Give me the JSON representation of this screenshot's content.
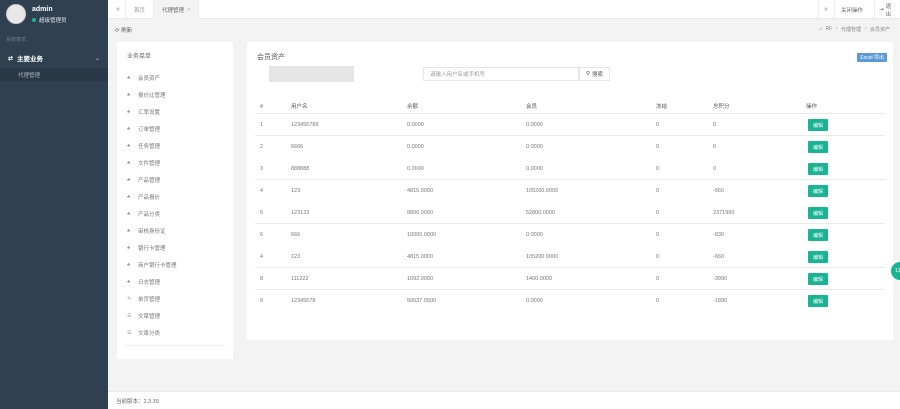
{
  "sidebar": {
    "username": "admin",
    "role": "超级管理员",
    "section_label": "系统菜单",
    "group_label": "主要业务",
    "sub_item": "代理管理"
  },
  "tabs": {
    "prev": "«",
    "next": "»",
    "home": "首页",
    "active": "代理管理",
    "close_ops": "关闭操作",
    "logout": "退出"
  },
  "toolbar": {
    "refresh": "刷新",
    "breadcrumb": [
      "RF",
      "代理管理",
      "会员资产"
    ]
  },
  "menu": {
    "title": "业务菜单",
    "items": [
      {
        "label": "会员资产",
        "icon": "users-icon"
      },
      {
        "label": "报价比管理",
        "icon": "users-icon"
      },
      {
        "label": "汇率设置",
        "icon": "users-icon"
      },
      {
        "label": "订单管理",
        "icon": "users-icon"
      },
      {
        "label": "任务管理",
        "icon": "users-icon"
      },
      {
        "label": "文件管理",
        "icon": "users-icon"
      },
      {
        "label": "产品管理",
        "icon": "users-icon"
      },
      {
        "label": "产品报价",
        "icon": "users-icon"
      },
      {
        "label": "产品分类",
        "icon": "users-icon"
      },
      {
        "label": "审核身份证",
        "icon": "users-icon"
      },
      {
        "label": "银行卡管理",
        "icon": "users-icon"
      },
      {
        "label": "商户银行卡管理",
        "icon": "users-icon"
      },
      {
        "label": "日志管理",
        "icon": "users-icon"
      },
      {
        "label": "单页管理",
        "icon": "edit-icon"
      },
      {
        "label": "文章管理",
        "icon": "list-icon"
      },
      {
        "label": "文章分类",
        "icon": "list-icon"
      }
    ]
  },
  "panel": {
    "title": "会员资产",
    "excel_button": "Excel 导出",
    "search_placeholder": "请输入用户名或手机号",
    "search_button": "搜索"
  },
  "table": {
    "headers": [
      "#",
      "用户名",
      "余额",
      "会员",
      "冻结",
      "总积分",
      "操作"
    ],
    "rows": [
      {
        "id": "1",
        "user": "123456789",
        "balance": "0.0000",
        "member": "0.0000",
        "frozen": "0",
        "points": "0",
        "op": "编辑"
      },
      {
        "id": "2",
        "user": "6666",
        "balance": "0.0000",
        "member": "0.0000",
        "frozen": "0",
        "points": "0",
        "op": "编辑"
      },
      {
        "id": "3",
        "user": "888888",
        "balance": "0.0000",
        "member": "0.0000",
        "frozen": "0",
        "points": "0",
        "op": "编辑"
      },
      {
        "id": "4",
        "user": "123",
        "balance": "4815.0000",
        "member": "105200.0000",
        "frozen": "0",
        "points": "-660",
        "op": "编辑"
      },
      {
        "id": "5",
        "user": "123123",
        "balance": "8806.0000",
        "member": "52800.0000",
        "frozen": "0",
        "points": "2371990",
        "op": "编辑"
      },
      {
        "id": "6",
        "user": "666",
        "balance": "10000.0000",
        "member": "0.0000",
        "frozen": "0",
        "points": "-830",
        "op": "编辑"
      },
      {
        "id": "4",
        "user": "123",
        "balance": "4815.0000",
        "member": "105200.0000",
        "frozen": "0",
        "points": "-660",
        "op": "编辑"
      },
      {
        "id": "8",
        "user": "111222",
        "balance": "1092.0000",
        "member": "1400.0000",
        "frozen": "0",
        "points": "-3990",
        "op": "编辑"
      },
      {
        "id": "9",
        "user": "12345678",
        "balance": "50637.0500",
        "member": "0.0000",
        "frozen": "0",
        "points": "-1890",
        "op": "编辑"
      }
    ]
  },
  "footer": {
    "version": "当前版本：2.3.39"
  },
  "float_badge": "13"
}
